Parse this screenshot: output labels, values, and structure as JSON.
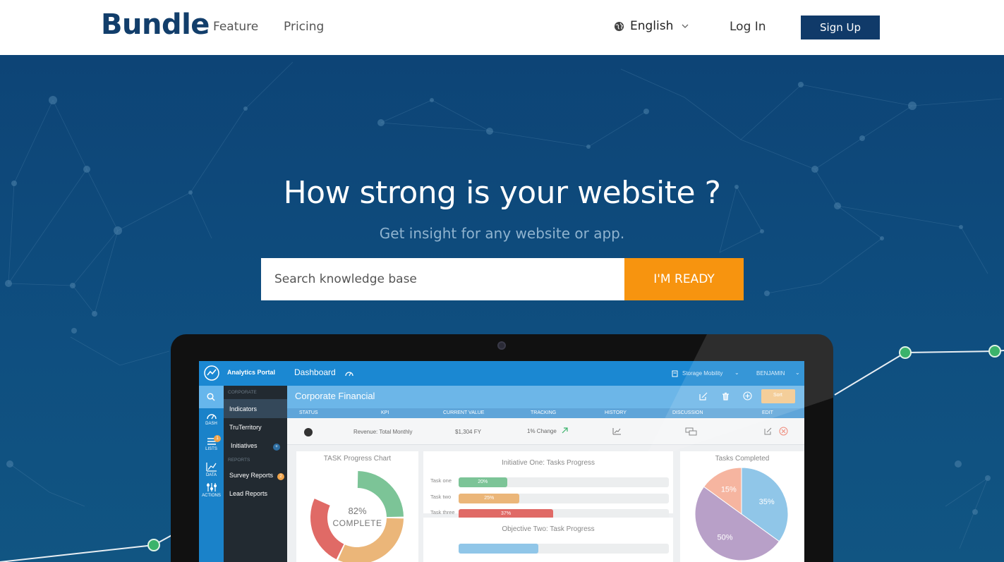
{
  "nav": {
    "brand": "Bundle",
    "feature": "Feature",
    "pricing": "Pricing",
    "language": "English",
    "login": "Log In",
    "signup": "Sign Up"
  },
  "hero": {
    "headline": "How strong is your website ?",
    "subhead": "Get insight for any website or app.",
    "search_placeholder": "Search knowledge base",
    "cta": "I'M READY"
  },
  "dashboard": {
    "app_name": "Analytics Portal",
    "page_title": "Dashboard",
    "workspace": "Storage Mobility",
    "user": "BENJAMIN",
    "section_title": "Corporate Financial",
    "sort_label": "Sort",
    "columns": [
      "STATUS",
      "KPI",
      "CURRENT VALUE",
      "TRACKING",
      "HISTORY",
      "DISCUSSION",
      "EDIT"
    ],
    "row": {
      "kpi": "Revenue: Total Monthly",
      "value": "$1,304 FY",
      "tracking": "1% Change"
    },
    "sidebar_icons": [
      "DASH",
      "LISTS",
      "DATA",
      "ACTIONS"
    ],
    "lists_badge": "1",
    "menu": {
      "corporate_label": "CORPORATE",
      "reports_label": "REPORTS",
      "items": [
        "Indicators",
        "TruTerritory",
        "Initiatives",
        "Survey Reports",
        "Lead Reports"
      ],
      "initiatives_badge": "+",
      "survey_badge": "2"
    },
    "task_chart": {
      "title": "TASK Progress Chart",
      "percent": "82%",
      "label": "COMPLETE",
      "segments": [
        {
          "name": "green",
          "value": 25,
          "color": "#7cc497"
        },
        {
          "name": "orange",
          "value": 32,
          "color": "#ebb679"
        },
        {
          "name": "red",
          "value": 25,
          "color": "#e06a66"
        }
      ]
    },
    "initiative": {
      "title": "Initiative One: Tasks Progress",
      "tasks": [
        {
          "label": "Task one",
          "value": "20%",
          "fraction": 0.23,
          "color": "#7cc497"
        },
        {
          "label": "Task two",
          "value": "25%",
          "fraction": 0.29,
          "color": "#ebb679"
        },
        {
          "label": "Task three",
          "value": "37%",
          "fraction": 0.45,
          "color": "#e06a66"
        }
      ]
    },
    "objective": {
      "title": "Objective Two: Task Progress"
    },
    "tasks_completed": {
      "title": "Tasks Completed",
      "slices": [
        {
          "label": "35%",
          "value": 35,
          "color": "#90c6e8"
        },
        {
          "label": "50%",
          "value": 50,
          "color": "#b8a0c8"
        },
        {
          "label": "15%",
          "value": 15,
          "color": "#f6b5a0"
        }
      ]
    }
  },
  "colors": {
    "brand": "#123e6b",
    "cta": "#f7940f",
    "signup": "#103a69",
    "hero_bg": "#0d4a7a"
  }
}
